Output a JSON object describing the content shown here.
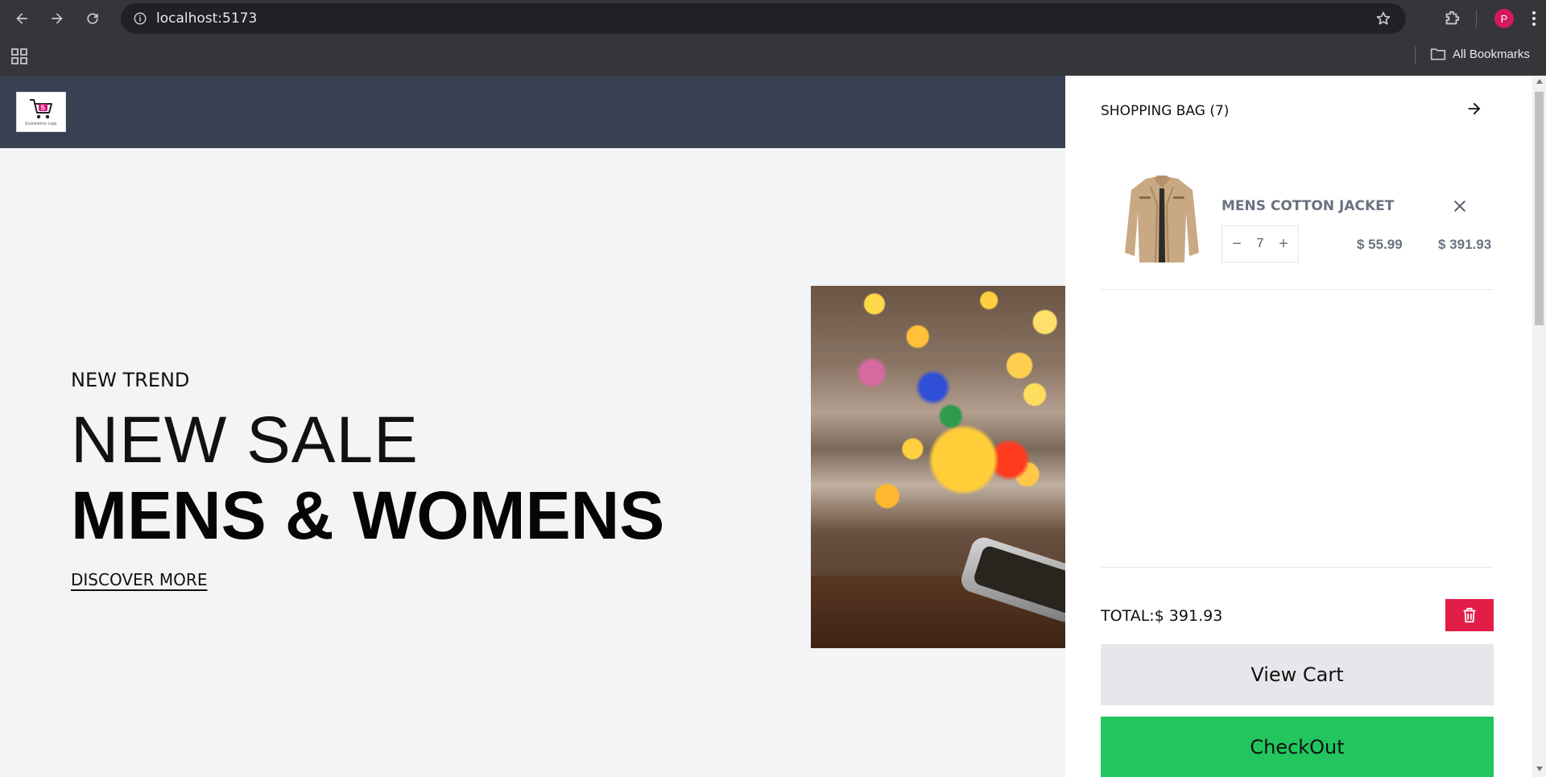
{
  "browser": {
    "url": "localhost:5173",
    "bookmarks_label": "All Bookmarks",
    "profile_initial": "P"
  },
  "site": {
    "logo_text": "Ecommerce Logo"
  },
  "hero": {
    "subtitle": "NEW TREND",
    "title_line1": "NEW SALE",
    "title_line2": "MENS & WOMENS",
    "link_label": "DISCOVER MORE"
  },
  "cart": {
    "title": "SHOPPING BAG (7)",
    "items": [
      {
        "name": "MENS COTTON JACKET",
        "quantity": "7",
        "unit_price": "$ 55.99",
        "line_total": "$ 391.93"
      }
    ],
    "total_label": "TOTAL:$ 391.93",
    "view_cart_label": "View Cart",
    "checkout_label": "CheckOut"
  },
  "colors": {
    "header_bg": "#374151",
    "checkout_bg": "#22c55e",
    "clear_bg": "#e11d48",
    "avatar_bg": "#d6185f"
  }
}
